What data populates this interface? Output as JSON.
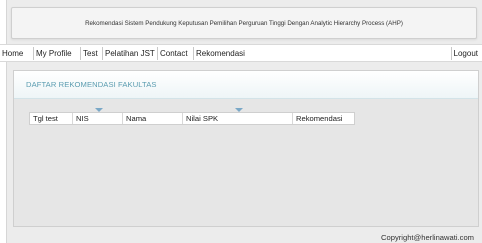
{
  "header": {
    "title": "Rekomendasi Sistem Pendukung Keputusan Pemilihan Perguruan Tinggi Dengan Analytic Hierarchy Process (AHP)"
  },
  "nav": {
    "items": [
      {
        "label": "Home"
      },
      {
        "label": "My Profile"
      },
      {
        "label": "Test"
      },
      {
        "label": "Pelatihan JST"
      },
      {
        "label": "Contact"
      },
      {
        "label": "Rekomendasi"
      }
    ],
    "logout": "Logout"
  },
  "panel": {
    "title": "DAFTAR REKOMENDASI FAKULTAS"
  },
  "table": {
    "columns": [
      "Tgl test",
      "NIS",
      "Nama",
      "Nilai SPK",
      "Rekomendasi"
    ]
  },
  "footer": {
    "copyright": "Copyright@herlinawati.com"
  }
}
